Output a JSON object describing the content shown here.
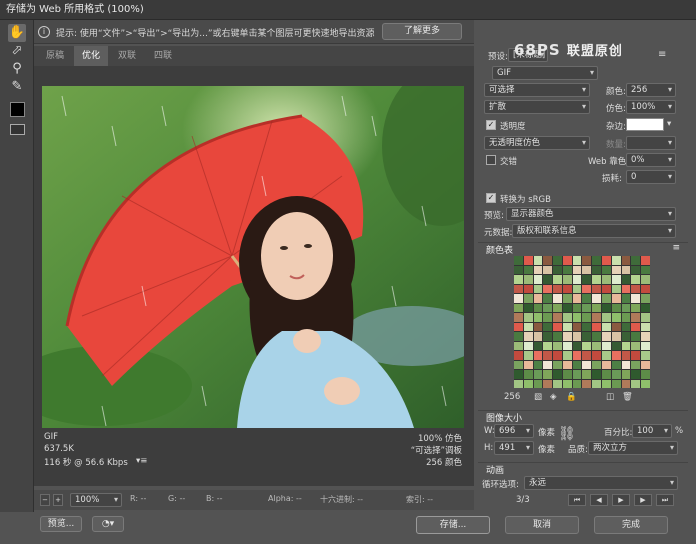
{
  "window": {
    "title": "存储为 Web 所用格式 (100%)"
  },
  "tip": {
    "text": "提示: 使用“文件”>“导出”>“导出为...”或右键单击某个图层可更快速地导出资源",
    "learn_more": "了解更多"
  },
  "tabs": [
    {
      "label": "原稿"
    },
    {
      "label": "优化"
    },
    {
      "label": "双联"
    },
    {
      "label": "四联"
    }
  ],
  "photo": {
    "description_icon": "photo-woman-red-umbrella"
  },
  "image_info": {
    "format": "GIF",
    "size": "637.5K",
    "time": "116 秒 @ 56.6 Kbps",
    "dither_pct": "100% 仿色",
    "palette": "“可选择”调板",
    "colors": "256 颜色"
  },
  "status": {
    "zoom": "100%",
    "r": "R: --",
    "g": "G: --",
    "b": "B: --",
    "alpha": "Alpha: --",
    "hex": "十六进制: --",
    "index": "索引: --"
  },
  "footer": {
    "preview": "预览...",
    "save": "存储...",
    "cancel": "取消",
    "done": "完成"
  },
  "watermark": {
    "brand": "68PS",
    "text": "联盟原创"
  },
  "panel": {
    "preset_label": "预设:",
    "preset_value": "[未标题]",
    "format": "GIF",
    "reduction": "可选择",
    "colors_label": "颜色:",
    "colors_value": "256",
    "dither_algo": "扩散",
    "dither_label": "仿色:",
    "dither_value": "100%",
    "transparency_label": "透明度",
    "matte_label": "杂边:",
    "transparency_dither": "无透明度仿色",
    "amount_label": "数量:",
    "interlaced_label": "交错",
    "web_snap_label": "Web 靠色:",
    "web_snap_value": "0%",
    "lossy_label": "损耗:",
    "lossy_value": "0",
    "convert_srgb_label": "转换为 sRGB",
    "preview_label": "预览:",
    "preview_value": "显示器颜色",
    "metadata_label": "元数据:",
    "metadata_value": "版权和联系信息"
  },
  "color_table": {
    "title": "颜色表",
    "count": "256",
    "colors": [
      "#3f6b3a",
      "#7fa65a",
      "#c24a3e",
      "#e6d2b8",
      "#8fbf6b",
      "#4d7f45",
      "#b3d48f",
      "#e05a4c",
      "#2f5a2e",
      "#a8c98a",
      "#d9c3a5",
      "#6b9a52",
      "#f2e6d6",
      "#9bbb78",
      "#c9e0ad",
      "#5d8c48",
      "#e87060",
      "#3a6036",
      "#b07a5a",
      "#7aa35f",
      "#dfeccf",
      "#8a5a40",
      "#6a9b58",
      "#c25848",
      "#4a7a40",
      "#a2c584",
      "#e8b89a",
      "#355a33"
    ]
  },
  "image_size": {
    "title": "图像大小",
    "w_label": "W:",
    "w_value": "696",
    "h_label": "H:",
    "h_value": "491",
    "unit": "像素",
    "percent_label": "百分比:",
    "percent_value": "100",
    "percent_unit": "%",
    "quality_label": "品质:",
    "quality_value": "两次立方"
  },
  "animation": {
    "title": "动画",
    "loop_label": "循环选项:",
    "loop_value": "永远",
    "frame": "3/3"
  }
}
